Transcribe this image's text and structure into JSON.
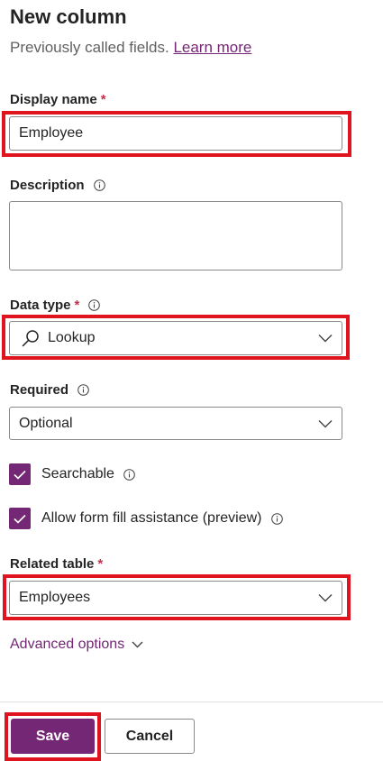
{
  "panel": {
    "title": "New column",
    "subtitle": "Previously called fields.",
    "learn_more": "Learn more"
  },
  "display_name": {
    "label": "Display name",
    "required_mark": "*",
    "value": "Employee"
  },
  "description": {
    "label": "Description",
    "value": ""
  },
  "data_type": {
    "label": "Data type",
    "required_mark": "*",
    "value": "Lookup",
    "icon": "search-icon"
  },
  "required": {
    "label": "Required",
    "value": "Optional"
  },
  "searchable": {
    "label": "Searchable",
    "checked": true
  },
  "form_fill": {
    "label": "Allow form fill assistance (preview)",
    "checked": true
  },
  "related_table": {
    "label": "Related table",
    "required_mark": "*",
    "value": "Employees"
  },
  "advanced": {
    "label": "Advanced options"
  },
  "footer": {
    "save_label": "Save",
    "cancel_label": "Cancel"
  },
  "colors": {
    "accent": "#742774",
    "highlight": "#e0141e",
    "required": "#c4314b"
  }
}
